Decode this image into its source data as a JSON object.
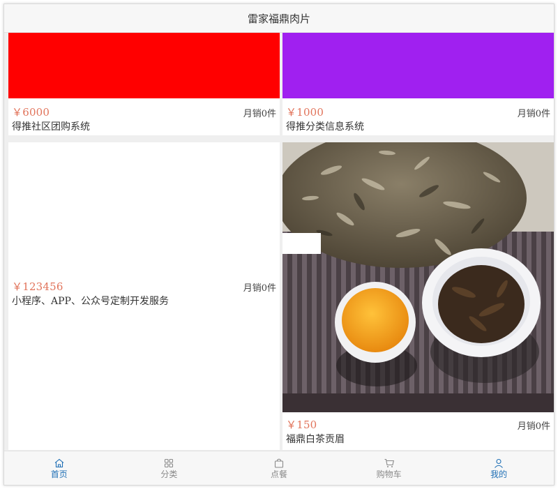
{
  "header": {
    "title": "雷家福鼎肉片"
  },
  "products": [
    {
      "price": "￥6000",
      "sales": "月销0件",
      "name": "得推社区团购系统",
      "image_color": "#ff0000"
    },
    {
      "price": "￥1000",
      "sales": "月销0件",
      "name": "得推分类信息系统",
      "image_color": "#a020f0"
    },
    {
      "price": "￥123456",
      "sales": "月销0件",
      "name": "小程序、APP、公众号定制开发服务",
      "image_color": "#ffffff"
    },
    {
      "price": "￥150",
      "sales": "月销0件",
      "name": "福鼎白茶贡眉",
      "image_icon": "tea-photo"
    }
  ],
  "tabbar": {
    "items": [
      {
        "label": "首页",
        "icon": "home-icon",
        "active": true
      },
      {
        "label": "分类",
        "icon": "grid-icon",
        "active": false
      },
      {
        "label": "点餐",
        "icon": "bag-icon",
        "active": false
      },
      {
        "label": "购物车",
        "icon": "cart-icon",
        "active": false
      },
      {
        "label": "我的",
        "icon": "user-icon",
        "active": true
      }
    ]
  },
  "colors": {
    "accent": "#1f6fb5",
    "price": "#e1735a",
    "background": "#efefef"
  }
}
